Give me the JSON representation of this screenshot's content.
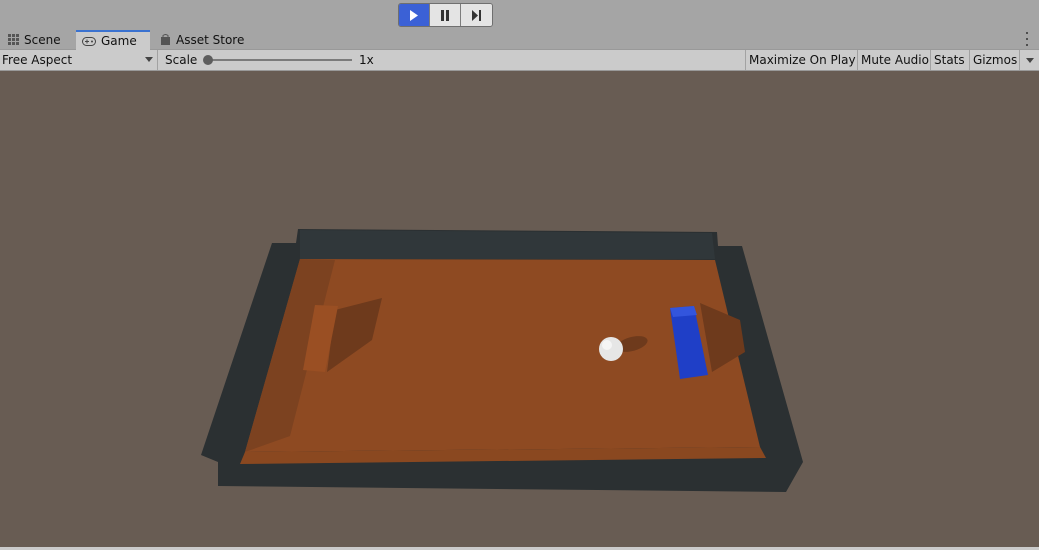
{
  "toolbar": {
    "play_icon": "play-icon",
    "pause_icon": "pause-icon",
    "step_icon": "step-icon",
    "play_active_color": "#3b61d6"
  },
  "tabs": [
    {
      "label": "Scene",
      "icon": "grid-icon"
    },
    {
      "label": "Game",
      "icon": "gamepad-icon",
      "active": true
    },
    {
      "label": "Asset Store",
      "icon": "bag-icon"
    }
  ],
  "controls": {
    "aspect": "Free Aspect",
    "scale_label": "Scale",
    "scale_value": "1x",
    "maximize": "Maximize On Play",
    "mute": "Mute Audio",
    "stats": "Stats",
    "gizmos": "Gizmos"
  },
  "scene": {
    "background_color": "#685c53",
    "floor_color": "#8e4a22",
    "wall_color": "#2b3032",
    "ball_color": "#e6e6e6",
    "paddle_right_color": "#1f3fc7",
    "paddle_left_color": "#9a4f23"
  }
}
